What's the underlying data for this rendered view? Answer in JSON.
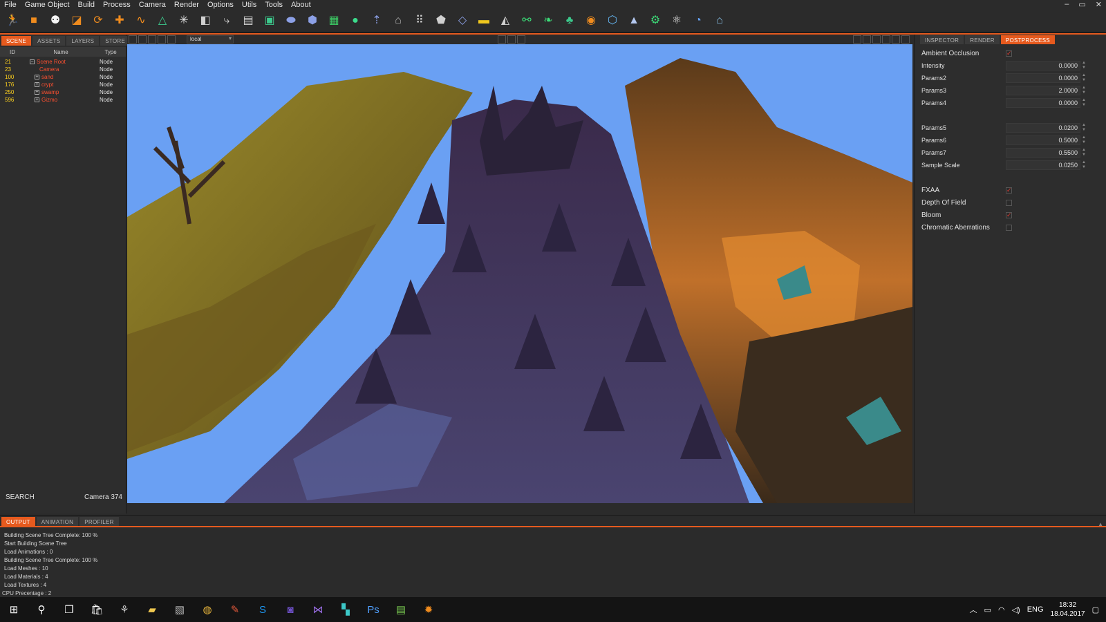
{
  "menu": [
    "File",
    "Game Object",
    "Build",
    "Process",
    "Camera",
    "Render",
    "Options",
    "Utils",
    "Tools",
    "About"
  ],
  "window_controls": [
    "–",
    "▭",
    "✕"
  ],
  "toolbar_icons": [
    {
      "name": "run-character-icon",
      "glyph": "🏃",
      "color": "#e65a1e"
    },
    {
      "name": "cube-icon",
      "glyph": "■",
      "color": "#f08c1e"
    },
    {
      "name": "node-graph-icon",
      "glyph": "⚉",
      "color": "#f5f5f5"
    },
    {
      "name": "scale-icon",
      "glyph": "◪",
      "color": "#f08c1e"
    },
    {
      "name": "rotate-icon",
      "glyph": "⟳",
      "color": "#f08c1e"
    },
    {
      "name": "move-icon",
      "glyph": "✚",
      "color": "#f08c1e"
    },
    {
      "name": "path-icon",
      "glyph": "∿",
      "color": "#f08c1e"
    },
    {
      "name": "triangle-mesh-icon",
      "glyph": "△",
      "color": "#3cc88c"
    },
    {
      "name": "particles-icon",
      "glyph": "✳",
      "color": "#e6e6e6"
    },
    {
      "name": "box-icon",
      "glyph": "◧",
      "color": "#d0d0d0"
    },
    {
      "name": "igs-import-icon",
      "glyph": "⤷",
      "color": "#d0d0d0"
    },
    {
      "name": "igs-file-icon",
      "glyph": "▤",
      "color": "#d0d0d0"
    },
    {
      "name": "igs-terrain-icon",
      "glyph": "▣",
      "color": "#3cc88c"
    },
    {
      "name": "capsule-icon",
      "glyph": "⬬",
      "color": "#8ca0e6"
    },
    {
      "name": "mesh-cube-icon",
      "glyph": "⬢",
      "color": "#8ca0e6"
    },
    {
      "name": "terrain-icon",
      "glyph": "▦",
      "color": "#3cc864"
    },
    {
      "name": "sphere-icon",
      "glyph": "●",
      "color": "#3cdc8c"
    },
    {
      "name": "lod-icon",
      "glyph": "⇡",
      "color": "#8ca0e6"
    },
    {
      "name": "building-icon",
      "glyph": "⌂",
      "color": "#b4b4b4"
    },
    {
      "name": "grid-points-icon",
      "glyph": "⠿",
      "color": "#d0d0d0"
    },
    {
      "name": "shield-icon",
      "glyph": "⬟",
      "color": "#d0d0d0"
    },
    {
      "name": "plane-icon",
      "glyph": "◇",
      "color": "#8ca0e6"
    },
    {
      "name": "ruler-icon",
      "glyph": "▬",
      "color": "#f0c81e"
    },
    {
      "name": "sail-icon",
      "glyph": "◭",
      "color": "#d0d0d0"
    },
    {
      "name": "nodes-link-icon",
      "glyph": "⚯",
      "color": "#3cdc78"
    },
    {
      "name": "leaf-icon",
      "glyph": "❧",
      "color": "#3cdc78"
    },
    {
      "name": "tree-icon",
      "glyph": "♣",
      "color": "#3cc88c"
    },
    {
      "name": "eye-icon",
      "glyph": "◉",
      "color": "#f08c1e"
    },
    {
      "name": "gem-icon",
      "glyph": "⬡",
      "color": "#64b4f0"
    },
    {
      "name": "mountain-icon",
      "glyph": "▲",
      "color": "#b4c8f0"
    },
    {
      "name": "gear-green-icon",
      "glyph": "⚙",
      "color": "#3cdc78"
    },
    {
      "name": "molecule-icon",
      "glyph": "⚛",
      "color": "#e6e6e6"
    },
    {
      "name": "clock-icon",
      "glyph": "◔",
      "color": "#64a0f0"
    },
    {
      "name": "house-icon",
      "glyph": "⌂",
      "color": "#8cc8f0"
    }
  ],
  "left_panel": {
    "tabs": [
      {
        "label": "SCENE",
        "active": true
      },
      {
        "label": "ASSETS"
      },
      {
        "label": "LAYERS"
      },
      {
        "label": "STORE"
      }
    ],
    "columns": [
      "ID",
      "Name",
      "Type"
    ],
    "rows": [
      {
        "id": "21",
        "name": "Scene Root",
        "type": "Node",
        "toggle": "−",
        "indent": 1
      },
      {
        "id": "23",
        "name": "Camera",
        "type": "Node",
        "toggle": "",
        "indent": 3
      },
      {
        "id": "100",
        "name": "sand",
        "type": "Node",
        "toggle": "+",
        "indent": 2
      },
      {
        "id": "176",
        "name": "crypt",
        "type": "Node",
        "toggle": "+",
        "indent": 2
      },
      {
        "id": "250",
        "name": "swamp",
        "type": "Node",
        "toggle": "+",
        "indent": 2
      },
      {
        "id": "596",
        "name": "Gizmo",
        "type": "Node",
        "toggle": "+",
        "indent": 2
      }
    ],
    "search_label": "SEARCH",
    "camera_label": "Camera 374"
  },
  "viewport": {
    "space_select": "local"
  },
  "right_panel": {
    "tabs": [
      {
        "label": "INSPECTOR"
      },
      {
        "label": "RENDER"
      },
      {
        "label": "POSTPROCESS",
        "active": true
      }
    ],
    "ambient_occlusion": {
      "label": "Ambient Occlusion",
      "checked": true
    },
    "params_a": [
      {
        "label": "Intensity",
        "value": "0.0000"
      },
      {
        "label": "Params2",
        "value": "0.0000"
      },
      {
        "label": "Params3",
        "value": "2.0000"
      },
      {
        "label": "Params4",
        "value": "0.0000"
      }
    ],
    "params_b": [
      {
        "label": "Params5",
        "value": "0.0200"
      },
      {
        "label": "Params6",
        "value": "0.5000"
      },
      {
        "label": "Params7",
        "value": "0.5500"
      },
      {
        "label": "Sample Scale",
        "value": "0.0250"
      }
    ],
    "toggles": [
      {
        "label": "FXAA",
        "checked": true
      },
      {
        "label": "Depth Of Field",
        "checked": false
      },
      {
        "label": "Bloom",
        "checked": true
      },
      {
        "label": "Chromatic Aberrations",
        "checked": false
      }
    ]
  },
  "bottom_panel": {
    "tabs": [
      {
        "label": "OUTPUT",
        "active": true
      },
      {
        "label": "ANIMATION"
      },
      {
        "label": "PROFILER"
      }
    ],
    "log": [
      "Building Scene Tree Complete: 100 %",
      "Start Building Scene Tree",
      "Load Animations : 0",
      "Building Scene Tree Complete: 100 %",
      "Load Meshes : 10",
      "Load Materials : 4",
      "Load Textures : 4"
    ],
    "status": "CPU Precentage : 2"
  },
  "taskbar": {
    "items": [
      {
        "name": "windows-start-icon",
        "glyph": "⊞",
        "color": "#ffffff"
      },
      {
        "name": "search-icon",
        "glyph": "⚲",
        "color": "#ffffff"
      },
      {
        "name": "task-view-icon",
        "glyph": "❐",
        "color": "#ffffff"
      },
      {
        "name": "store-icon",
        "glyph": "🛍",
        "color": "#ffffff"
      },
      {
        "name": "app-icon",
        "glyph": "⚘",
        "color": "#cccccc"
      },
      {
        "name": "file-explorer-icon",
        "glyph": "▰",
        "color": "#f0c850"
      },
      {
        "name": "tool-icon",
        "glyph": "▧",
        "color": "#bbbbbb"
      },
      {
        "name": "chrome-icon",
        "glyph": "◍",
        "color": "#e6b43c"
      },
      {
        "name": "editor-icon",
        "glyph": "✎",
        "color": "#e65a3c"
      },
      {
        "name": "skype-icon",
        "glyph": "S",
        "color": "#1e96f0"
      },
      {
        "name": "game-icon",
        "glyph": "◙",
        "color": "#6e50c8"
      },
      {
        "name": "visual-studio-icon",
        "glyph": "⋈",
        "color": "#9b6ee6"
      },
      {
        "name": "app-teal-icon",
        "glyph": "▚",
        "color": "#3cc8c8"
      },
      {
        "name": "photoshop-icon",
        "glyph": "Ps",
        "color": "#50a0ff"
      },
      {
        "name": "notepad-icon",
        "glyph": "▤",
        "color": "#78c850"
      },
      {
        "name": "engine-icon",
        "glyph": "✹",
        "color": "#f08c1e"
      }
    ],
    "tray": {
      "lang": "ENG",
      "time": "18:32",
      "date": "18.04.2017"
    }
  }
}
